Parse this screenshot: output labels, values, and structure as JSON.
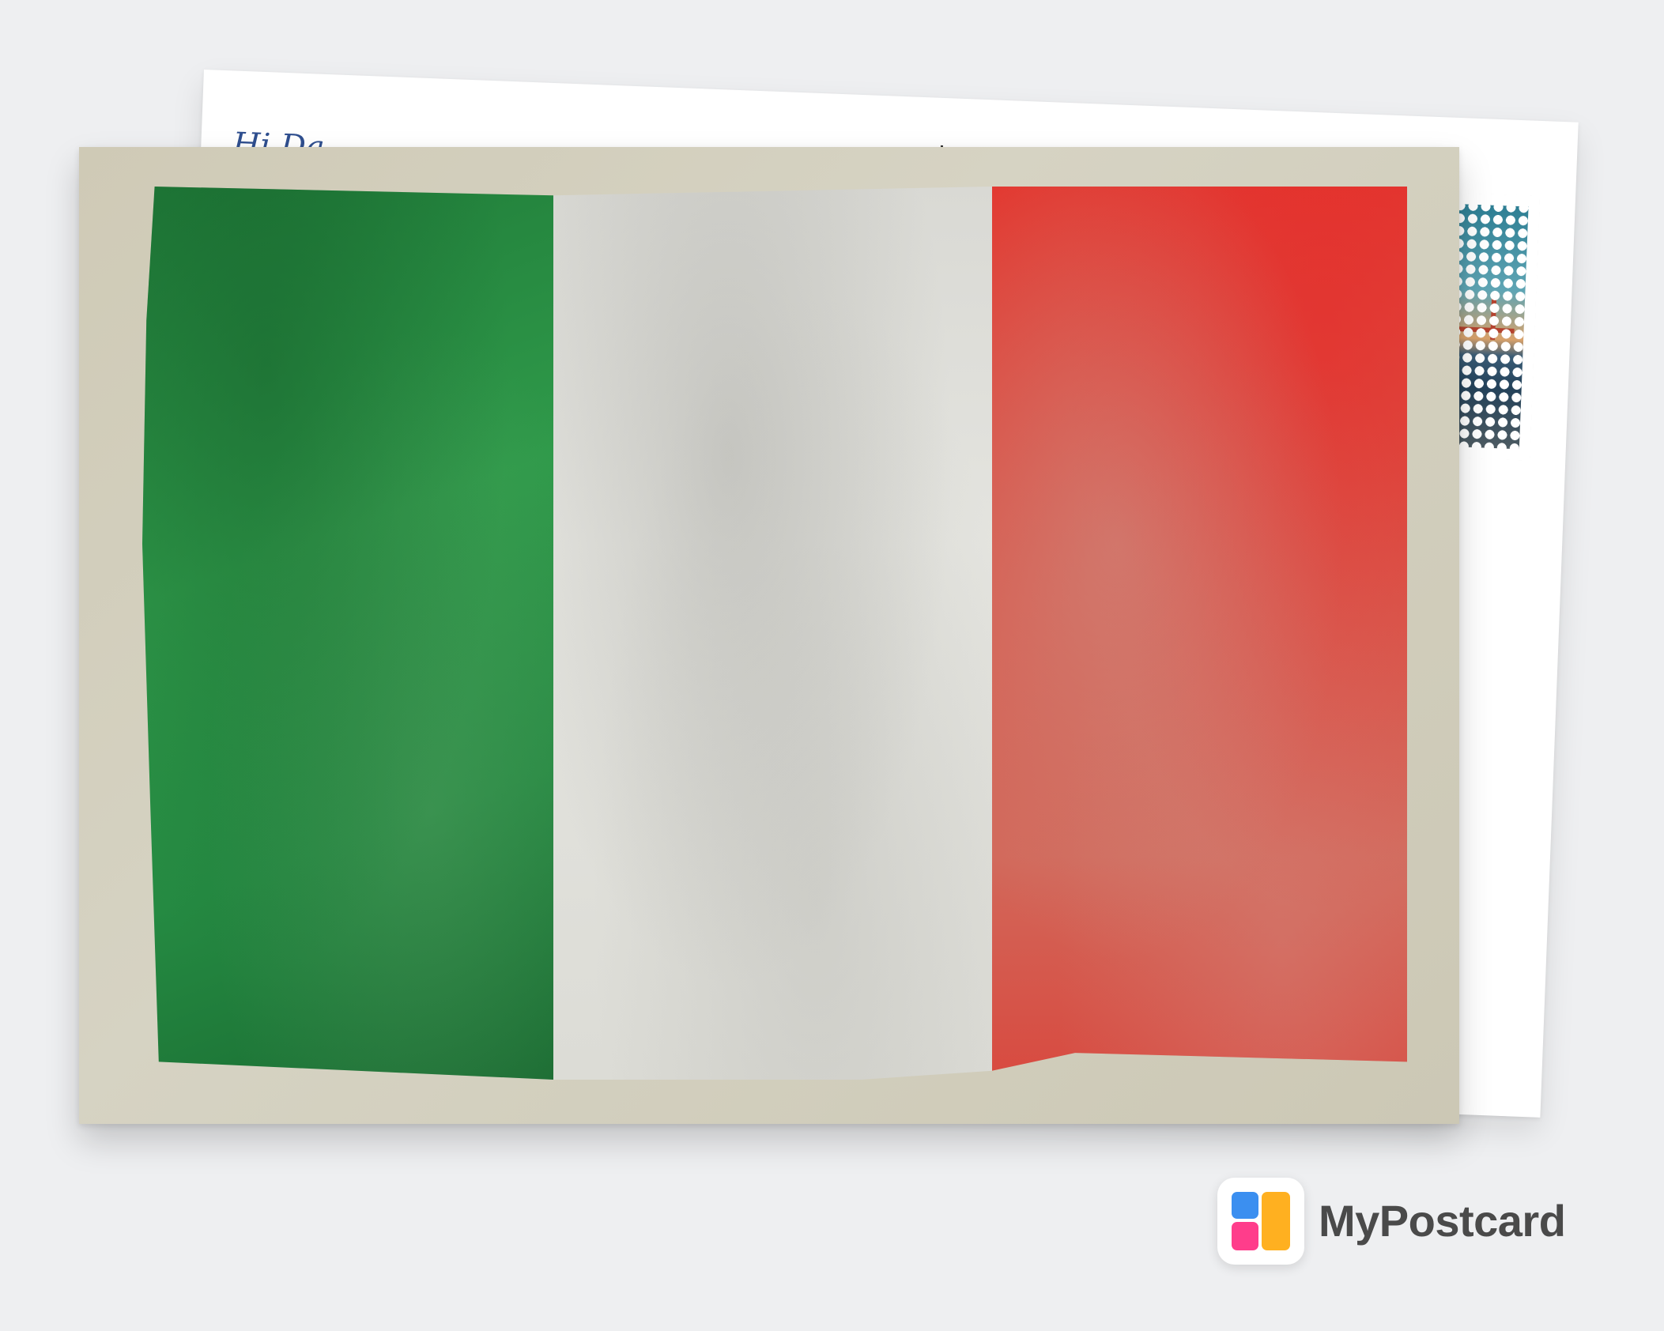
{
  "back_card": {
    "greeting": "Hi Da...",
    "stamp_image": "golden-gate-bridge-photo"
  },
  "front_card": {
    "design": "italy-flag-grunge",
    "stripe_colors": [
      "#2a8c44",
      "#e0e0db",
      "#dd4a40"
    ]
  },
  "brand": {
    "name": "MyPostcard",
    "logo_colors": [
      "#3b8ff0",
      "#ff9f1a",
      "#ff3d8b",
      "#ffd21a"
    ]
  }
}
